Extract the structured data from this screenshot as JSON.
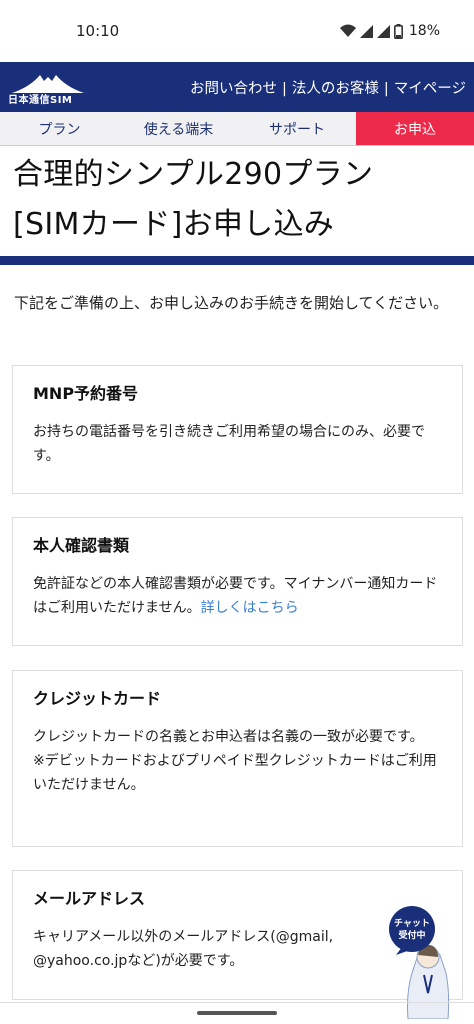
{
  "status_bar": {
    "time": "10:10",
    "battery": "18%",
    "icons": [
      "wifi-icon",
      "signal-icon",
      "signal-icon",
      "battery-icon"
    ]
  },
  "header": {
    "logo_text": "日本通信SIM",
    "links": [
      "お問い合わせ",
      "法人のお客様",
      "マイページ"
    ],
    "separator": "|",
    "brand_color": "#1a2f7a"
  },
  "tabs": [
    {
      "label": "プラン"
    },
    {
      "label": "使える端末"
    },
    {
      "label": "サポート"
    },
    {
      "label": "お申込",
      "active": true
    }
  ],
  "accent_color": "#ee2a4b",
  "page": {
    "title_line1": "合理的シンプル290プラン",
    "title_line2": "[SIMカード]お申し込み",
    "intro": "下記をご準備の上、お申し込みのお手続きを開始してください。"
  },
  "cards": [
    {
      "title": "MNP予約番号",
      "body": "お持ちの電話番号を引き続きご利用希望の場合にのみ、必要です。"
    },
    {
      "title": "本人確認書類",
      "body": "免許証などの本人確認書類が必要です。マイナンバー通知カードはご利用いただけません。",
      "link": "詳しくはこちら"
    },
    {
      "title": "クレジットカード",
      "body": "クレジットカードの名義とお申込者は名義の一致が必要です。",
      "note": "※デビットカードおよびプリペイド型クレジットカードはご利用いただけません。"
    },
    {
      "title": "メールアドレス",
      "body": "キャリアメール以外のメールアドレス(@gmail, @yahoo.co.jpなど)が必要です。"
    }
  ],
  "chat": {
    "line1": "チャット",
    "line2": "受付中"
  }
}
